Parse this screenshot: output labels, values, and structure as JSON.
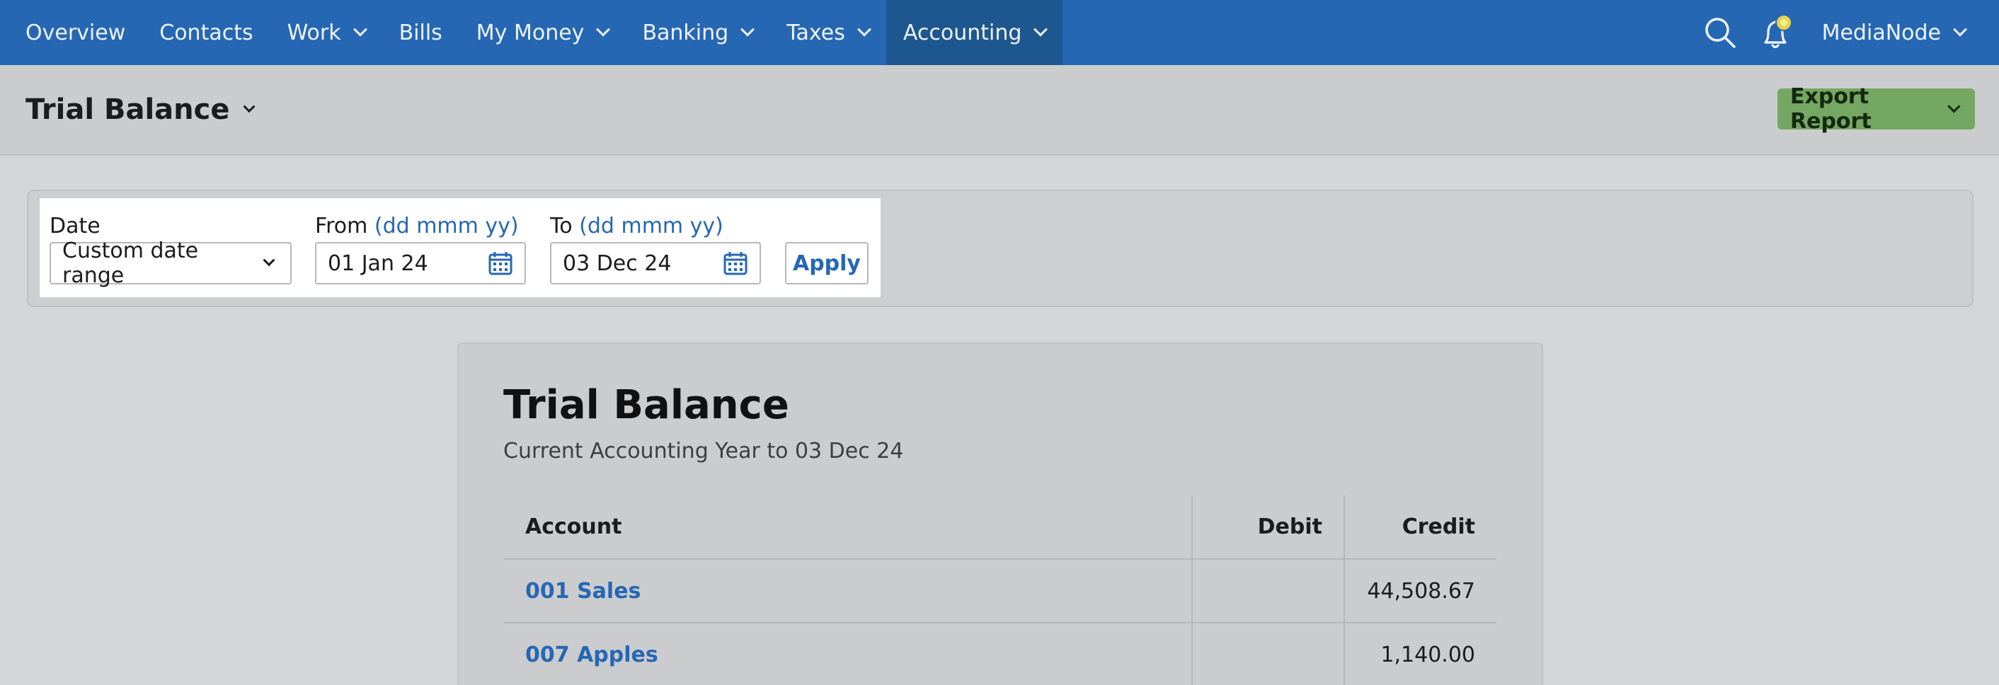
{
  "nav": {
    "items": [
      {
        "label": "Overview",
        "has_menu": false
      },
      {
        "label": "Contacts",
        "has_menu": false
      },
      {
        "label": "Work",
        "has_menu": true
      },
      {
        "label": "Bills",
        "has_menu": false
      },
      {
        "label": "My Money",
        "has_menu": true
      },
      {
        "label": "Banking",
        "has_menu": true
      },
      {
        "label": "Taxes",
        "has_menu": true
      },
      {
        "label": "Accounting",
        "has_menu": true,
        "active": true
      }
    ],
    "icons": [
      "search-icon",
      "notifications-bell-icon"
    ],
    "user_label": "MediaNode",
    "colors": {
      "bar": "#2667b4",
      "active": "#1e578f",
      "bell_badge": "#e8d44d"
    }
  },
  "header": {
    "title": "Trial Balance",
    "export_label": "Export Report",
    "export_color": "#74a762"
  },
  "filters": {
    "date_label": "Date",
    "date_value": "Custom date range",
    "from_label": "From",
    "from_hint": "(dd mmm yy)",
    "from_value": "01 Jan 24",
    "to_label": "To",
    "to_hint": "(dd mmm yy)",
    "to_value": "03 Dec 24",
    "apply_label": "Apply"
  },
  "report": {
    "title": "Trial Balance",
    "subtitle": "Current Accounting Year to 03 Dec 24",
    "columns": {
      "account": "Account",
      "debit": "Debit",
      "credit": "Credit"
    },
    "rows": [
      {
        "account": "001 Sales",
        "debit": "",
        "credit": "44,508.67"
      },
      {
        "account": "007 Apples",
        "debit": "",
        "credit": "1,140.00"
      }
    ]
  }
}
